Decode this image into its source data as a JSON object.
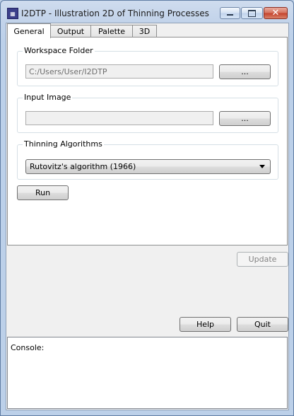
{
  "window": {
    "title": "I2DTP - Illustration 2D of Thinning Processes"
  },
  "icons": {
    "app": "app-icon",
    "minimize": "minimize-icon",
    "maximize": "maximize-icon",
    "close": "close-icon",
    "dropdown": "chevron-down-icon"
  },
  "tabs": [
    {
      "label": "General"
    },
    {
      "label": "Output"
    },
    {
      "label": "Palette"
    },
    {
      "label": "3D"
    }
  ],
  "general": {
    "workspace": {
      "label": "Workspace Folder",
      "value": "C:/Users/User/I2DTP",
      "browse": "..."
    },
    "input_image": {
      "label": "Input Image",
      "value": "",
      "browse": "..."
    },
    "algorithms": {
      "label": "Thinning Algorithms",
      "selected": "Rutovitz's algorithm (1966)"
    },
    "run": "Run"
  },
  "buttons": {
    "update": "Update",
    "help": "Help",
    "quit": "Quit"
  },
  "console": {
    "label": "Console:"
  }
}
